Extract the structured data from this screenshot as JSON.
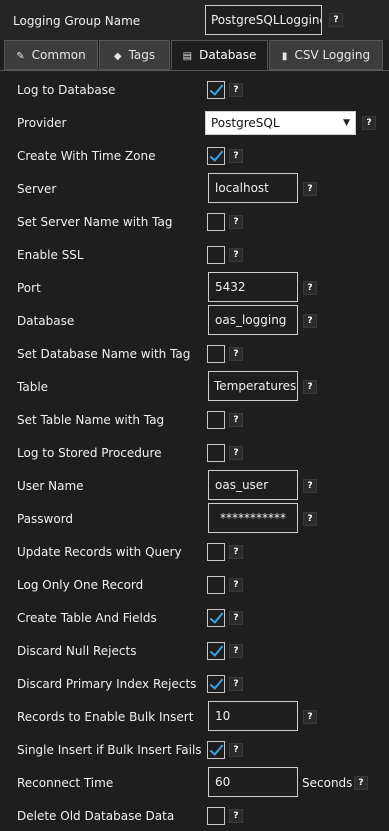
{
  "header": {
    "group_name_label": "Logging Group Name",
    "group_name_value": "PostgreSQLLogging"
  },
  "help_glyph": "?",
  "tabs": [
    {
      "label": "Common",
      "icon": "wrench-icon",
      "glyph": "✎",
      "active": false
    },
    {
      "label": "Tags",
      "icon": "tag-icon",
      "glyph": "◆",
      "active": false
    },
    {
      "label": "Database",
      "icon": "database-icon",
      "glyph": "▤",
      "active": true
    },
    {
      "label": "CSV Logging",
      "icon": "chart-icon",
      "glyph": "▮",
      "active": false
    }
  ],
  "fields": {
    "log_to_database": {
      "label": "Log to Database",
      "checked": true
    },
    "provider": {
      "label": "Provider",
      "value": "PostgreSQL"
    },
    "create_with_time_zone": {
      "label": "Create With Time Zone",
      "checked": true
    },
    "server": {
      "label": "Server",
      "value": "localhost"
    },
    "set_server_name_with_tag": {
      "label": "Set Server Name with Tag",
      "checked": false
    },
    "enable_ssl": {
      "label": "Enable SSL",
      "checked": false
    },
    "port": {
      "label": "Port",
      "value": "5432"
    },
    "database": {
      "label": "Database",
      "value": "oas_logging"
    },
    "set_database_name_with_tag": {
      "label": "Set Database Name with Tag",
      "checked": false
    },
    "table": {
      "label": "Table",
      "value": "Temperatures"
    },
    "set_table_name_with_tag": {
      "label": "Set Table Name with Tag",
      "checked": false
    },
    "log_to_stored_procedure": {
      "label": "Log to Stored Procedure",
      "checked": false
    },
    "user_name": {
      "label": "User Name",
      "value": "oas_user"
    },
    "password": {
      "label": "Password",
      "value": "***********"
    },
    "update_records_with_query": {
      "label": "Update Records with Query",
      "checked": false
    },
    "log_only_one_record": {
      "label": "Log Only One Record",
      "checked": false
    },
    "create_table_and_fields": {
      "label": "Create Table And Fields",
      "checked": true
    },
    "discard_null_rejects": {
      "label": "Discard Null Rejects",
      "checked": true
    },
    "discard_primary_index_rejects": {
      "label": "Discard Primary Index Rejects",
      "checked": true
    },
    "records_to_enable_bulk_insert": {
      "label": "Records to Enable Bulk Insert",
      "value": "10"
    },
    "single_insert_if_bulk_insert_fails": {
      "label": "Single Insert if Bulk Insert Fails",
      "checked": true
    },
    "reconnect_time": {
      "label": "Reconnect Time",
      "value": "60",
      "unit": "Seconds"
    },
    "delete_old_database_data": {
      "label": "Delete Old Database Data",
      "checked": false
    }
  },
  "colors": {
    "check_mark": "#3fa0e6",
    "background": "#1e1e1e"
  }
}
